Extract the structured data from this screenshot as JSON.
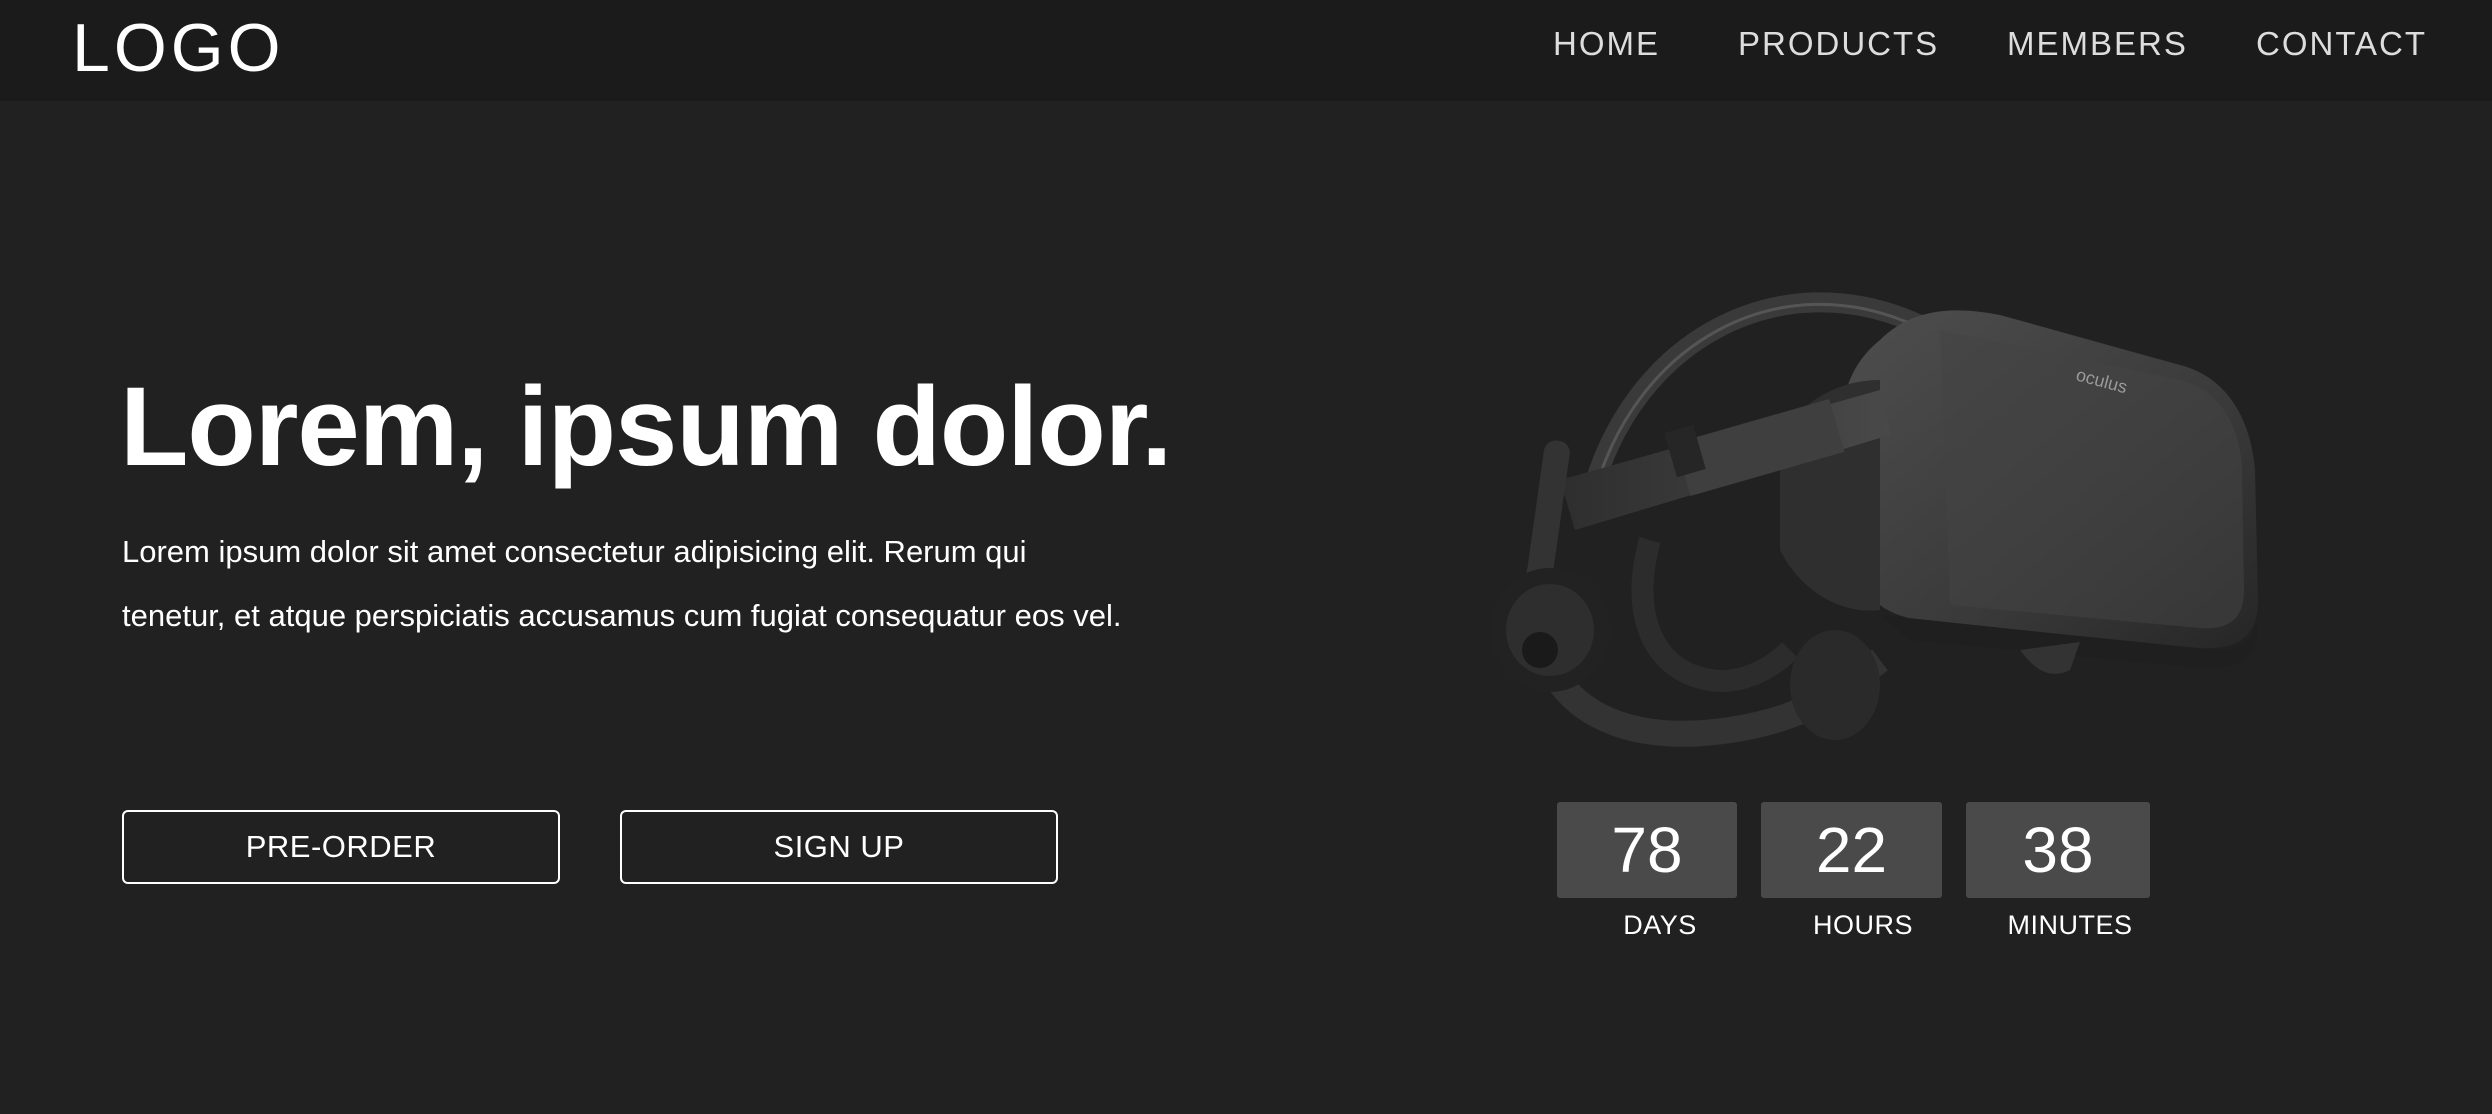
{
  "nav": {
    "logo": "LOGO",
    "links": [
      "HOME",
      "PRODUCTS",
      "MEMBERS",
      "CONTACT"
    ]
  },
  "hero": {
    "title": "Lorem, ipsum dolor.",
    "text": "Lorem ipsum dolor sit amet consectetur adipisicing elit. Rerum qui tenetur, et atque perspiciatis accusamus cum fugiat consequatur eos vel.",
    "preorder_label": "PRE-ORDER",
    "signup_label": "SIGN UP"
  },
  "product": {
    "brand_mark": "oculus",
    "image_icon": "vr-headset-icon"
  },
  "countdown": [
    {
      "value": "78",
      "label": "DAYS"
    },
    {
      "value": "22",
      "label": "HOURS"
    },
    {
      "value": "38",
      "label": "MINUTES"
    }
  ],
  "colors": {
    "background": "#212121",
    "navbar": "#1b1b1b",
    "countdown_box": "#4a4a4a",
    "text": "#ffffff"
  }
}
